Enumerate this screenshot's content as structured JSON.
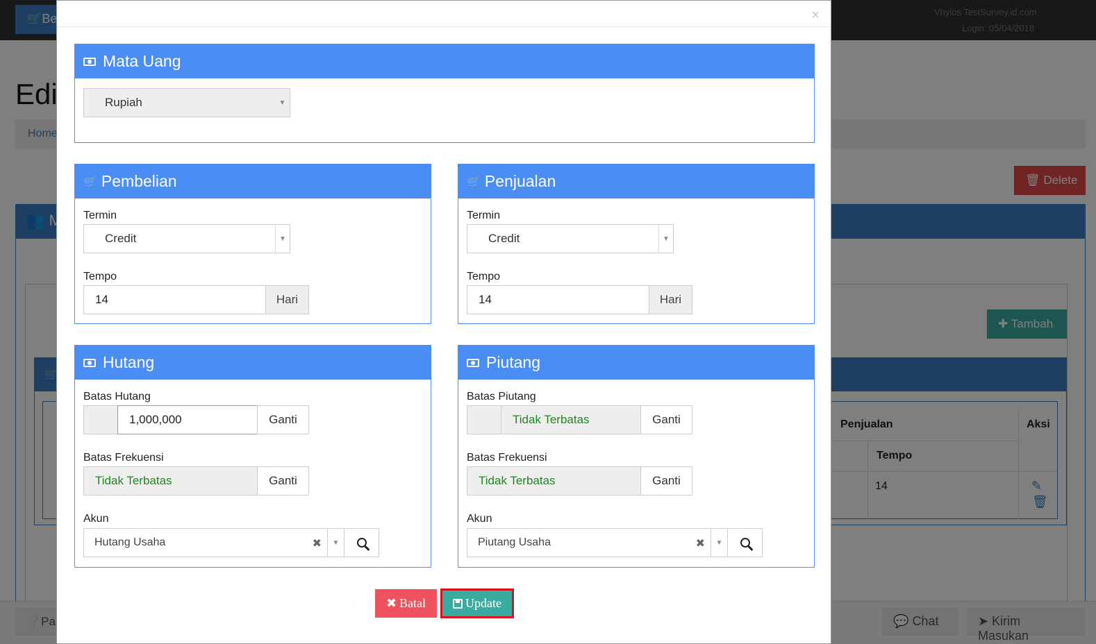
{
  "background": {
    "beli_btn": "Be",
    "user_line1": "Vhylos TestSurvey.id.com",
    "user_line2": "Login: 05/04/2018",
    "page_title": "Edi",
    "breadcrumb": "Home",
    "delete_btn": "Delete",
    "panel_title": "Mi",
    "tambah_btn": "Tambah",
    "table": {
      "col_penjualan": "Penjualan",
      "col_aksi": "Aksi",
      "col_tempo": "Tempo",
      "row_tempo": "14"
    },
    "footer_left": "Pa",
    "chat_btn": "Chat",
    "kirim_btn": "Kirim Masukan"
  },
  "modal": {
    "close": "×",
    "mata_uang": {
      "title": "Mata Uang",
      "selected": "Rupiah"
    },
    "pembelian": {
      "title": "Pembelian",
      "termin_label": "Termin",
      "termin_value": "Credit",
      "tempo_label": "Tempo",
      "tempo_value": "14",
      "tempo_unit": "Hari"
    },
    "penjualan": {
      "title": "Penjualan",
      "termin_label": "Termin",
      "termin_value": "Credit",
      "tempo_label": "Tempo",
      "tempo_value": "14",
      "tempo_unit": "Hari"
    },
    "hutang": {
      "title": "Hutang",
      "batas_label": "Batas Hutang",
      "batas_value": "1,000,000",
      "ganti1": "Ganti",
      "frek_label": "Batas Frekuensi",
      "frek_value": "Tidak Terbatas",
      "ganti2": "Ganti",
      "akun_label": "Akun",
      "akun_value": "Hutang Usaha"
    },
    "piutang": {
      "title": "Piutang",
      "batas_label": "Batas Piutang",
      "batas_value": "Tidak Terbatas",
      "ganti1": "Ganti",
      "frek_label": "Batas Frekuensi",
      "frek_value": "Tidak Terbatas",
      "ganti2": "Ganti",
      "akun_label": "Akun",
      "akun_value": "Piutang Usaha"
    },
    "batal_btn": "Batal",
    "update_btn": "Update"
  }
}
